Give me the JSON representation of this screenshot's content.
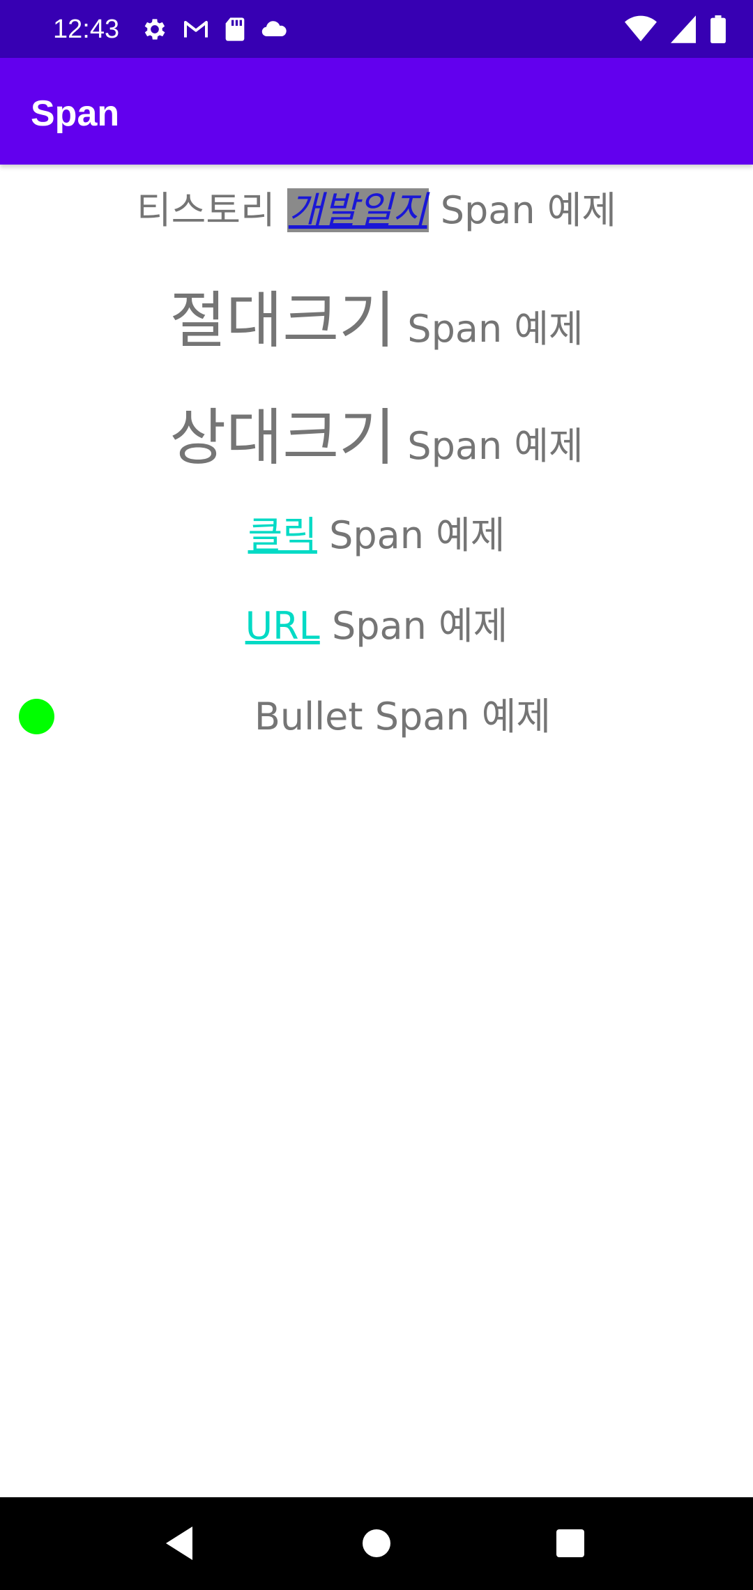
{
  "status_bar": {
    "time": "12:43",
    "left_icons": [
      "settings-icon",
      "gmail-icon",
      "sd-card-icon",
      "cloud-icon"
    ],
    "right_icons": [
      "wifi-icon",
      "cellular-signal-icon",
      "battery-icon"
    ],
    "background": "#3700B3"
  },
  "app_bar": {
    "title": "Span",
    "background": "#6200EE"
  },
  "content": {
    "row1": {
      "prefix": "티스토리 ",
      "highlight": "개발일지",
      "suffix": " Span 예제"
    },
    "row2": {
      "big": "절대크기",
      "suffix": " Span 예제"
    },
    "row3": {
      "big": "상대크기",
      "suffix": " Span 예제"
    },
    "row4": {
      "link": "클릭",
      "suffix": " Span 예제"
    },
    "row5": {
      "link": "URL",
      "suffix": " Span 예제"
    },
    "row6": {
      "text": "Bullet Span 예제",
      "bullet_color": "#00FF00"
    }
  },
  "colors": {
    "text": "#757575",
    "link": "#03DAC5",
    "highlight_bg": "#8A8A8A",
    "highlight_fg": "#1A17D6"
  },
  "nav_bar": {
    "icons": [
      "back-icon",
      "home-icon",
      "recents-icon"
    ]
  }
}
